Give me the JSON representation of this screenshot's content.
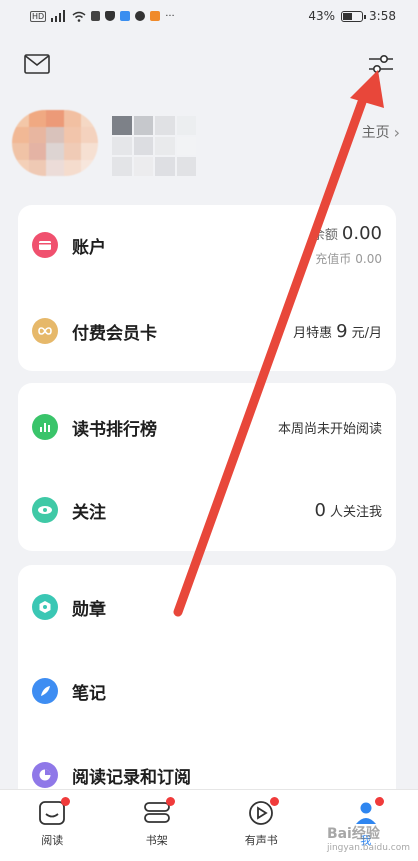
{
  "status_bar": {
    "left_badges": "HD",
    "dots": "···",
    "battery_text": "43%",
    "battery_level": 0.43,
    "time": "3:58"
  },
  "profile": {
    "homepage_label": "主页",
    "homepage_chevron": "›"
  },
  "card_account": {
    "account": {
      "label": "账户",
      "balance_label": "余额",
      "balance_value": "0.00",
      "coin_label": "充值币",
      "coin_value": "0.00"
    },
    "membership": {
      "label": "付费会员卡",
      "promo_prefix": "月特惠",
      "promo_price": "9",
      "promo_unit": "元/月"
    }
  },
  "card_social": {
    "ranking": {
      "label": "读书排行榜",
      "status": "本周尚未开始阅读"
    },
    "follow": {
      "label": "关注",
      "count": "0",
      "suffix": "人关注我"
    }
  },
  "card_misc": {
    "medals": {
      "label": "勋章"
    },
    "notes": {
      "label": "笔记"
    },
    "history": {
      "label": "阅读记录和订阅"
    }
  },
  "tabs": [
    {
      "label": "阅读",
      "icon": "read-icon",
      "badge": true
    },
    {
      "label": "书架",
      "icon": "bookshelf-icon",
      "badge": true
    },
    {
      "label": "有声书",
      "icon": "audiobook-icon",
      "badge": true
    },
    {
      "label": "我",
      "icon": "me-icon",
      "badge": true
    }
  ],
  "colors": {
    "accent_red": "#f03b3b",
    "arrow": "#e8473a",
    "account_icon": "#f0506e",
    "membership_icon": "#e6b86a",
    "ranking_icon": "#39c46a",
    "follow_icon": "#3fc9a6",
    "medals_icon": "#3ac7b4",
    "notes_icon": "#3e8df2",
    "history_icon": "#8f78e8"
  },
  "watermark": {
    "main": "Bai经验",
    "sub": "jingyan.baidu.com"
  }
}
